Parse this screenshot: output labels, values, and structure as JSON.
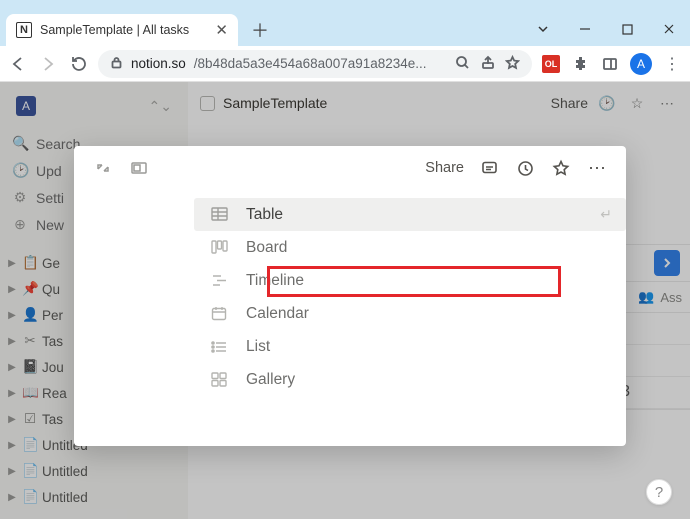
{
  "browser": {
    "tab_title": "SampleTemplate | All tasks",
    "url_host": "notion.so",
    "url_path": "/8b48da5a3e454a68a007a91a8234e...",
    "ext_badge": "OL",
    "avatar_letter": "A"
  },
  "sidebar": {
    "workspace_letter": "A",
    "quick": [
      {
        "icon": "🔍",
        "label": "Search"
      },
      {
        "icon": "🕑",
        "label": "Upd"
      },
      {
        "icon": "⚙",
        "label": "Setti"
      },
      {
        "icon": "⊕",
        "label": "New"
      }
    ],
    "pages": [
      {
        "icon": "📋",
        "label": "Ge"
      },
      {
        "icon": "📌",
        "label": "Qu"
      },
      {
        "icon": "👤",
        "label": "Per"
      },
      {
        "icon": "✂",
        "label": "Tas"
      },
      {
        "icon": "📓",
        "label": "Jou"
      },
      {
        "icon": "📖",
        "label": "Rea"
      },
      {
        "icon": "☑",
        "label": "Tas"
      },
      {
        "icon": "📄",
        "label": "Untitled"
      },
      {
        "icon": "📄",
        "label": "Untitled"
      },
      {
        "icon": "📄",
        "label": "Untitled"
      }
    ]
  },
  "page": {
    "title": "SampleTemplate",
    "share": "Share",
    "assign_col": "Ass",
    "row3_hint": "3"
  },
  "modal": {
    "share": "Share",
    "views": [
      {
        "icon": "table",
        "label": "Table",
        "selected": true
      },
      {
        "icon": "board",
        "label": "Board"
      },
      {
        "icon": "timeline",
        "label": "Timeline"
      },
      {
        "icon": "calendar",
        "label": "Calendar"
      },
      {
        "icon": "list",
        "label": "List"
      },
      {
        "icon": "gallery",
        "label": "Gallery"
      }
    ]
  },
  "help_label": "?"
}
